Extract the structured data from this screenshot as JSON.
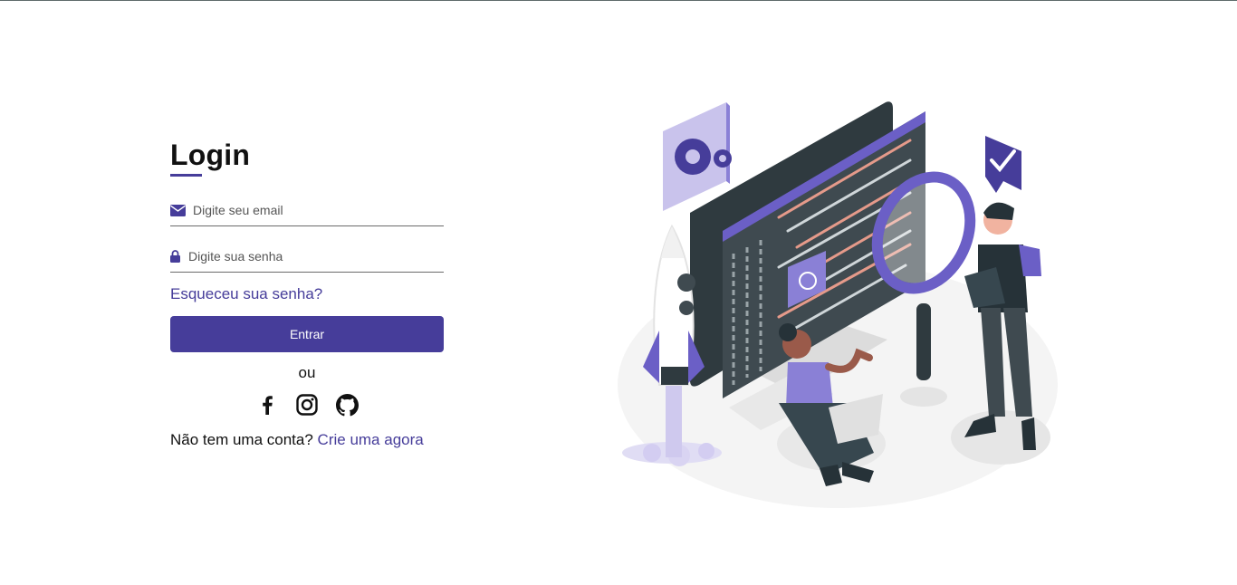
{
  "login": {
    "title": "Login",
    "email_placeholder": "Digite seu email",
    "password_placeholder": "Digite sua senha",
    "forgot_link": "Esqueceu sua senha?",
    "submit_label": "Entrar",
    "or_text": "ou",
    "socials": [
      {
        "icon": "facebook-icon"
      },
      {
        "icon": "instagram-icon"
      },
      {
        "icon": "github-icon"
      }
    ],
    "signup_prompt": "Não tem uma conta?",
    "signup_link": "Crie uma agora"
  },
  "colors": {
    "accent": "#463d9a",
    "background": "#ffffff",
    "text": "#111111"
  }
}
